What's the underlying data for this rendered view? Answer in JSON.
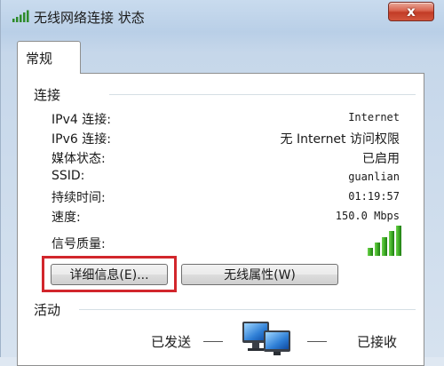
{
  "window": {
    "title": "无线网络连接 状态",
    "close_label": "x"
  },
  "tabs": [
    {
      "label": "常规"
    }
  ],
  "connection": {
    "heading": "连接",
    "rows": [
      {
        "label": "IPv4 连接:",
        "value": "Internet"
      },
      {
        "label": "IPv6 连接:",
        "value": "无 Internet 访问权限"
      },
      {
        "label": "媒体状态:",
        "value": "已启用"
      },
      {
        "label": "SSID:",
        "value": "guanlian"
      },
      {
        "label": "持续时间:",
        "value": "01:19:57"
      },
      {
        "label": "速度:",
        "value": "150.0 Mbps"
      }
    ],
    "signal_label": "信号质量:",
    "signal_bars_lit": 5,
    "signal_bars_total": 5
  },
  "buttons": {
    "details": "详细信息(E)...",
    "wireless_props": "无线属性(W)"
  },
  "activity": {
    "heading": "活动",
    "sent_label": "已发送",
    "received_label": "已接收"
  },
  "colors": {
    "highlight": "#d2262c",
    "signal_green": "#3fae25"
  }
}
